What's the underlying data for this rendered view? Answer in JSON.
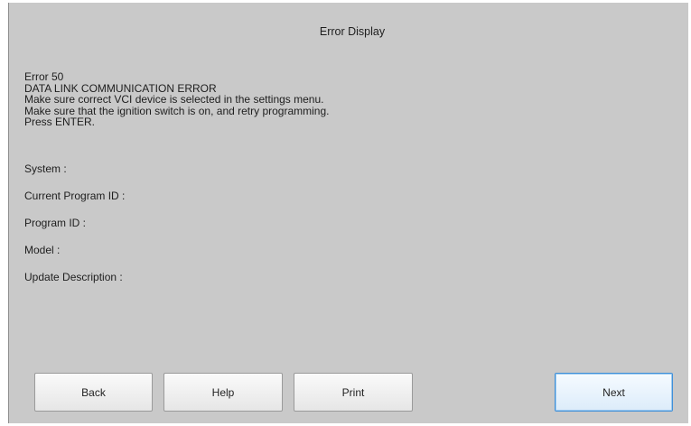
{
  "window": {
    "title": "Error Display"
  },
  "message": {
    "lines": [
      "Error 50",
      "DATA LINK COMMUNICATION ERROR",
      "Make sure correct VCI device is selected in the settings menu.",
      "Make sure that the ignition switch is on, and retry programming.",
      "Press ENTER."
    ]
  },
  "fields": {
    "system": "System :",
    "current_program_id": "Current Program ID :",
    "program_id": "Program ID :",
    "model": "Model :",
    "update_description": "Update Description :"
  },
  "buttons": {
    "back": "Back",
    "help": "Help",
    "print": "Print",
    "next": "Next"
  }
}
